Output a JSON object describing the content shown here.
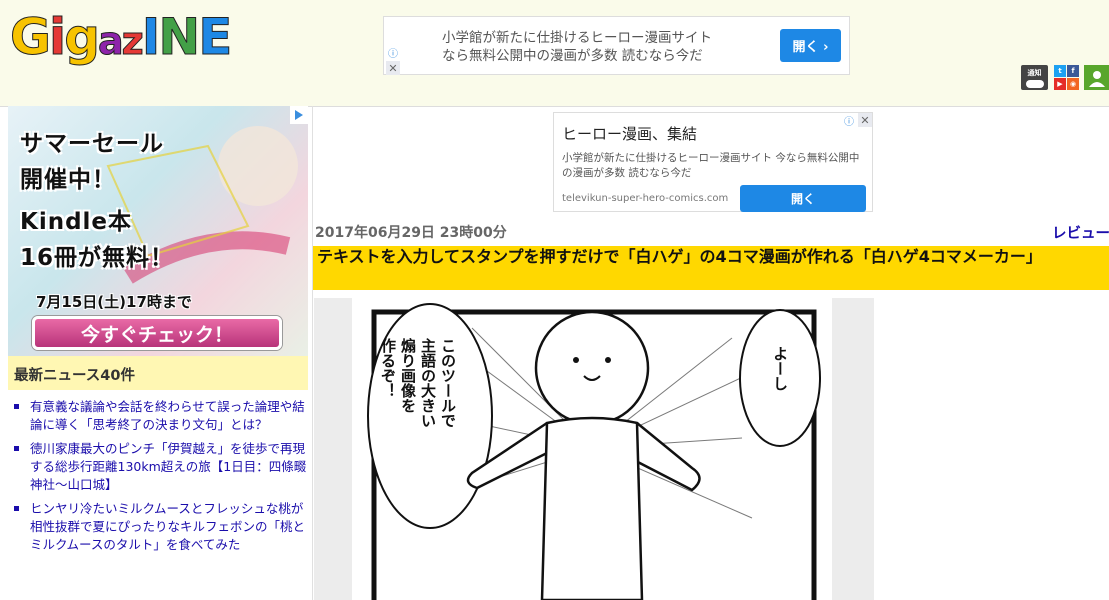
{
  "header": {
    "logo": [
      "G",
      "i",
      "g",
      "a",
      "z",
      "I",
      "N",
      "E"
    ],
    "logo_colors": [
      "#f7c300",
      "#e53935",
      "#f7c300",
      "#8e24aa",
      "#e53935",
      "#1e88e5",
      "#43a047",
      "#1e88e5"
    ],
    "top_ad": {
      "line1": "小学館が新たに仕掛けるヒーロー漫画サイト",
      "line2": "なら無料公開中の漫画が多数 読むなら今だ",
      "button": "開く ›"
    },
    "social": {
      "notify_label": "通知",
      "icons": [
        "notification-icon",
        "twitter-icon",
        "facebook-icon",
        "youtube-icon",
        "rss-icon",
        "user-icon"
      ]
    }
  },
  "sidebar": {
    "promo": {
      "line1": "サマーセール",
      "line2": "開催中！",
      "line3": "Kindle本",
      "line4": "16冊が無料！",
      "until": "7月15日(土)17時まで",
      "cta": "今すぐチェック！"
    },
    "news_heading": "最新ニュース40件",
    "news": [
      "有意義な議論や会話を終わらせて誤った論理や結論に導く「思考終了の決まり文句」とは？",
      "徳川家康最大のピンチ「伊賀越え」を徒歩で再現する総歩行距離130km超えの旅【1日目：四條畷神社〜山口城】",
      "ヒンヤリ冷たいミルクムースとフレッシュな桃が相性抜群で夏にぴったりなキルフェボンの「桃とミルクムースのタルト」を食べてみた"
    ]
  },
  "main": {
    "mid_ad": {
      "headline": "ヒーロー漫画、集結",
      "desc": "小学館が新たに仕掛けるヒーロー漫画サイト 今なら無料公開中の漫画が多数 読むなら今だ",
      "url": "televikun-super-hero-comics.com",
      "button": "開く"
    },
    "date": "2017年06月29日 23時00分",
    "category": "レビュー",
    "title": "テキストを入力してスタンプを押すだけで「白ハゲ」の4コマ漫画が作れる「白ハゲ4コマメーカー」",
    "comic": {
      "bubble_left": [
        "このツールで",
        "主語の大きい",
        "煽り画像を",
        "作るぞ！"
      ],
      "bubble_right": [
        "よーし"
      ]
    }
  }
}
